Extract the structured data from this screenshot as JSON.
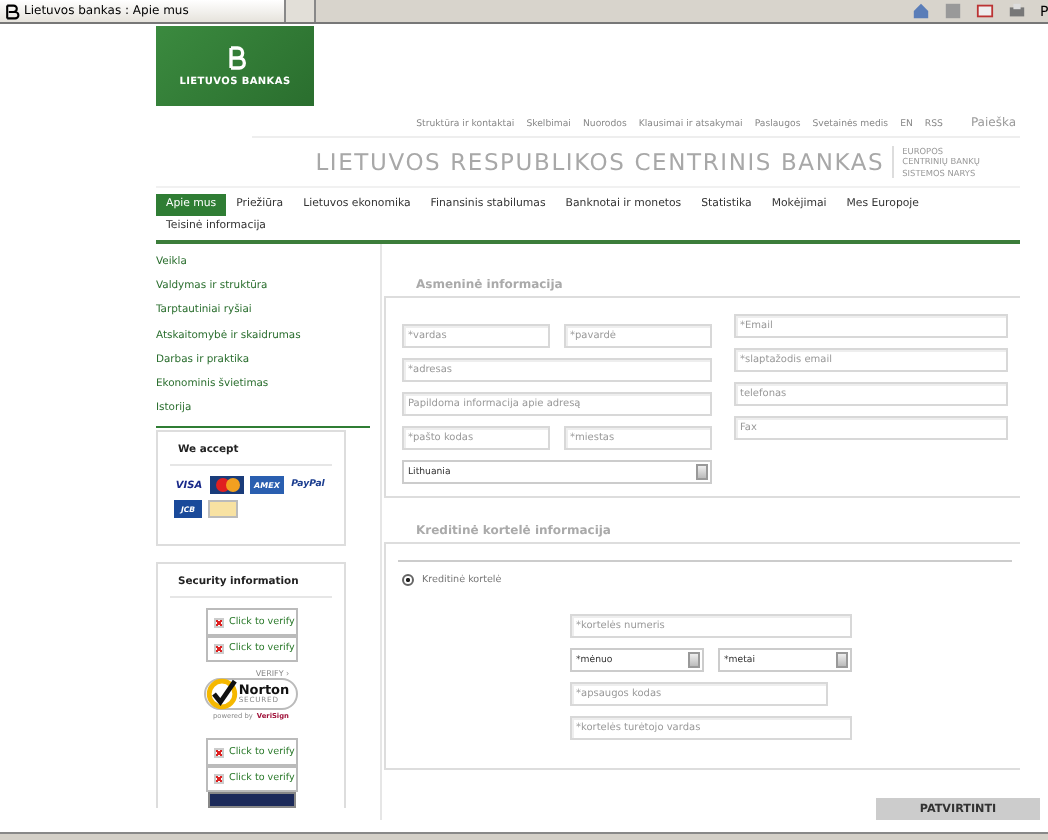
{
  "browser": {
    "tab_title": "Lietuvos bankas : Apie mus",
    "toolbar_cut_text": "P"
  },
  "header": {
    "logo_text": "LIETUVOS BANKAS",
    "utility_links": [
      "Struktūra ir kontaktai",
      "Skelbimai",
      "Nuorodos",
      "Klausimai ir atsakymai",
      "Paslaugos",
      "Svetainės medis",
      "EN",
      "RSS"
    ],
    "search_link": "Paieška",
    "title": "LIETUVOS RESPUBLIKOS CENTRINIS BANKAS",
    "tagline": [
      "EUROPOS",
      "CENTRINIŲ BANKŲ",
      "SISTEMOS NARYS"
    ]
  },
  "nav": [
    {
      "label": "Apie mus",
      "selected": true
    },
    {
      "label": "Priežiūra",
      "selected": false
    },
    {
      "label": "Lietuvos ekonomika",
      "selected": false
    },
    {
      "label": "Finansinis stabilumas",
      "selected": false
    },
    {
      "label": "Banknotai ir monetos",
      "selected": false
    },
    {
      "label": "Statistika",
      "selected": false
    },
    {
      "label": "Mokėjimai",
      "selected": false
    },
    {
      "label": "Mes Europoje",
      "selected": false
    },
    {
      "label": "Teisinė informacija",
      "selected": false
    }
  ],
  "sidebar": {
    "items": [
      "Veikla",
      "Valdymas ir struktūra",
      "Tarptautiniai ryšiai",
      "Atskaitomybė ir skaidrumas",
      "Darbas ir praktika",
      "Ekonominis švietimas",
      "Istorija"
    ],
    "accept_box": {
      "title": "We accept",
      "cards": [
        {
          "kind": "visa",
          "label": "VISA"
        },
        {
          "kind": "mastercard"
        },
        {
          "kind": "amex",
          "label": "AMEX"
        },
        {
          "kind": "paypal",
          "label": "PayPal"
        },
        {
          "kind": "jcb",
          "label": "JCB"
        },
        {
          "kind": "generic"
        }
      ]
    },
    "security_box": {
      "title": "Security information",
      "badges": [
        {
          "kind": "verify",
          "label": "Click to verify"
        },
        {
          "kind": "verify",
          "label": "Click to verify"
        },
        {
          "kind": "norton",
          "verify": "VERIFY ›",
          "name": "Norton",
          "secured": "SECURED",
          "powered_by": "powered by",
          "brand": "VeriSign"
        },
        {
          "kind": "verify",
          "label": "Click to verify"
        },
        {
          "kind": "verify",
          "label": "Click to verify"
        },
        {
          "kind": "seal"
        }
      ]
    }
  },
  "personal_section": {
    "title": "Asmeninė informacija",
    "left_rows": [
      [
        {
          "kind": "input",
          "placeholder": "*vardas"
        },
        {
          "kind": "input",
          "placeholder": "*pavardė"
        }
      ],
      [
        {
          "kind": "input",
          "placeholder": "*adresas"
        }
      ],
      [
        {
          "kind": "input",
          "placeholder": "Papildoma informacija apie adresą"
        }
      ],
      [
        {
          "kind": "input",
          "placeholder": "*pašto kodas"
        },
        {
          "kind": "input",
          "placeholder": "*miestas"
        }
      ],
      [
        {
          "kind": "select",
          "value": "Lithuania"
        }
      ]
    ],
    "right_fields": [
      {
        "kind": "input",
        "placeholder": "*Email"
      },
      {
        "kind": "input",
        "placeholder": "*slaptažodis email"
      },
      {
        "kind": "input",
        "placeholder": "telefonas"
      },
      {
        "kind": "input",
        "placeholder": "Fax"
      }
    ]
  },
  "card_section": {
    "title": "Kreditinė kortelė informacija",
    "payment_option": {
      "label": "Kreditinė kortelė",
      "selected": true
    },
    "rows": [
      [
        {
          "kind": "input",
          "placeholder": "*kortelės numeris"
        }
      ],
      [
        {
          "kind": "select",
          "value": "*mėnuo"
        },
        {
          "kind": "select",
          "value": "*metai"
        }
      ],
      [
        {
          "kind": "input",
          "placeholder": "*apsaugos kodas",
          "short": true
        }
      ],
      [
        {
          "kind": "input",
          "placeholder": "*kortelės turėtojo vardas"
        }
      ]
    ]
  },
  "submit_button": "PATVIRTINTI"
}
